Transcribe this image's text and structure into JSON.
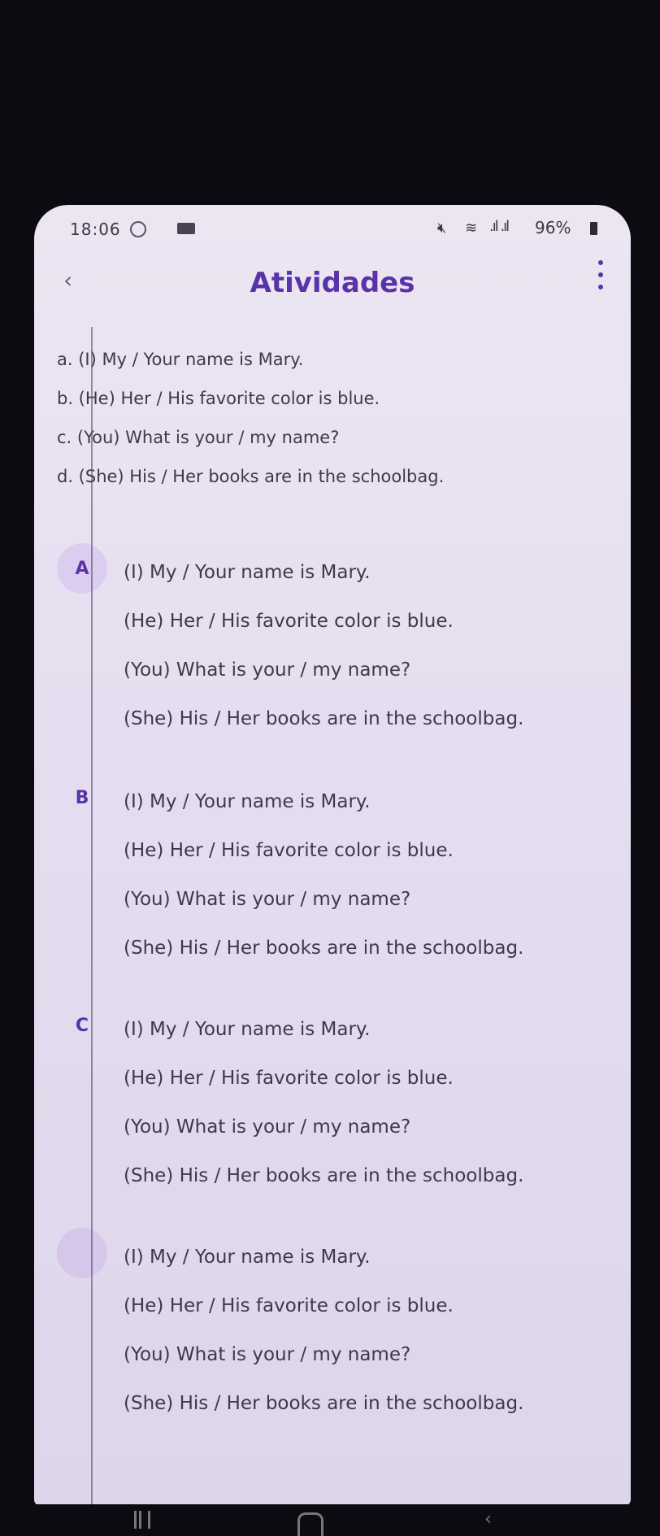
{
  "status_bar": {
    "time": "18:06",
    "wifi_icon": "wifi-icon",
    "signal": ".ıl .ıl",
    "battery": "96%",
    "mute_icon": "mute-icon"
  },
  "app_bar": {
    "back_icon": "‹",
    "title": "Atividades",
    "more_icon": "more-vert-icon"
  },
  "question": {
    "lines": [
      "a. (I) My / Your name is Mary.",
      "b. (He) Her / His favorite color is blue.",
      "c. (You) What is your / my name?",
      "d. (She) His / Her books are in the schoolbag."
    ]
  },
  "options": [
    {
      "letter": "A",
      "lines": [
        "(I) My / Your name is Mary.",
        "(He) Her / His favorite color is blue.",
        "(You) What is your / my name?",
        "(She) His / Her books are in the schoolbag."
      ]
    },
    {
      "letter": "B",
      "lines": [
        "(I) My / Your name is Mary.",
        "(He) Her / His favorite color is blue.",
        "(You) What is your / my name?",
        "(She) His / Her books are in the schoolbag."
      ]
    },
    {
      "letter": "C",
      "lines": [
        "(I) My / Your name is Mary.",
        "(He) Her / His favorite color is blue.",
        "(You) What is your / my name?",
        "(She) His / Her books are in the schoolbag."
      ]
    },
    {
      "letter": "",
      "lines": [
        "(I) My / Your name is Mary.",
        "(He) Her / His favorite color is blue.",
        "(You) What is your / my name?",
        "(She) His / Her books are in the schoolbag."
      ]
    }
  ],
  "colors": {
    "accent": "#5a33a8",
    "badge_bg": "#dbcdef",
    "text": "#3e3a48"
  }
}
